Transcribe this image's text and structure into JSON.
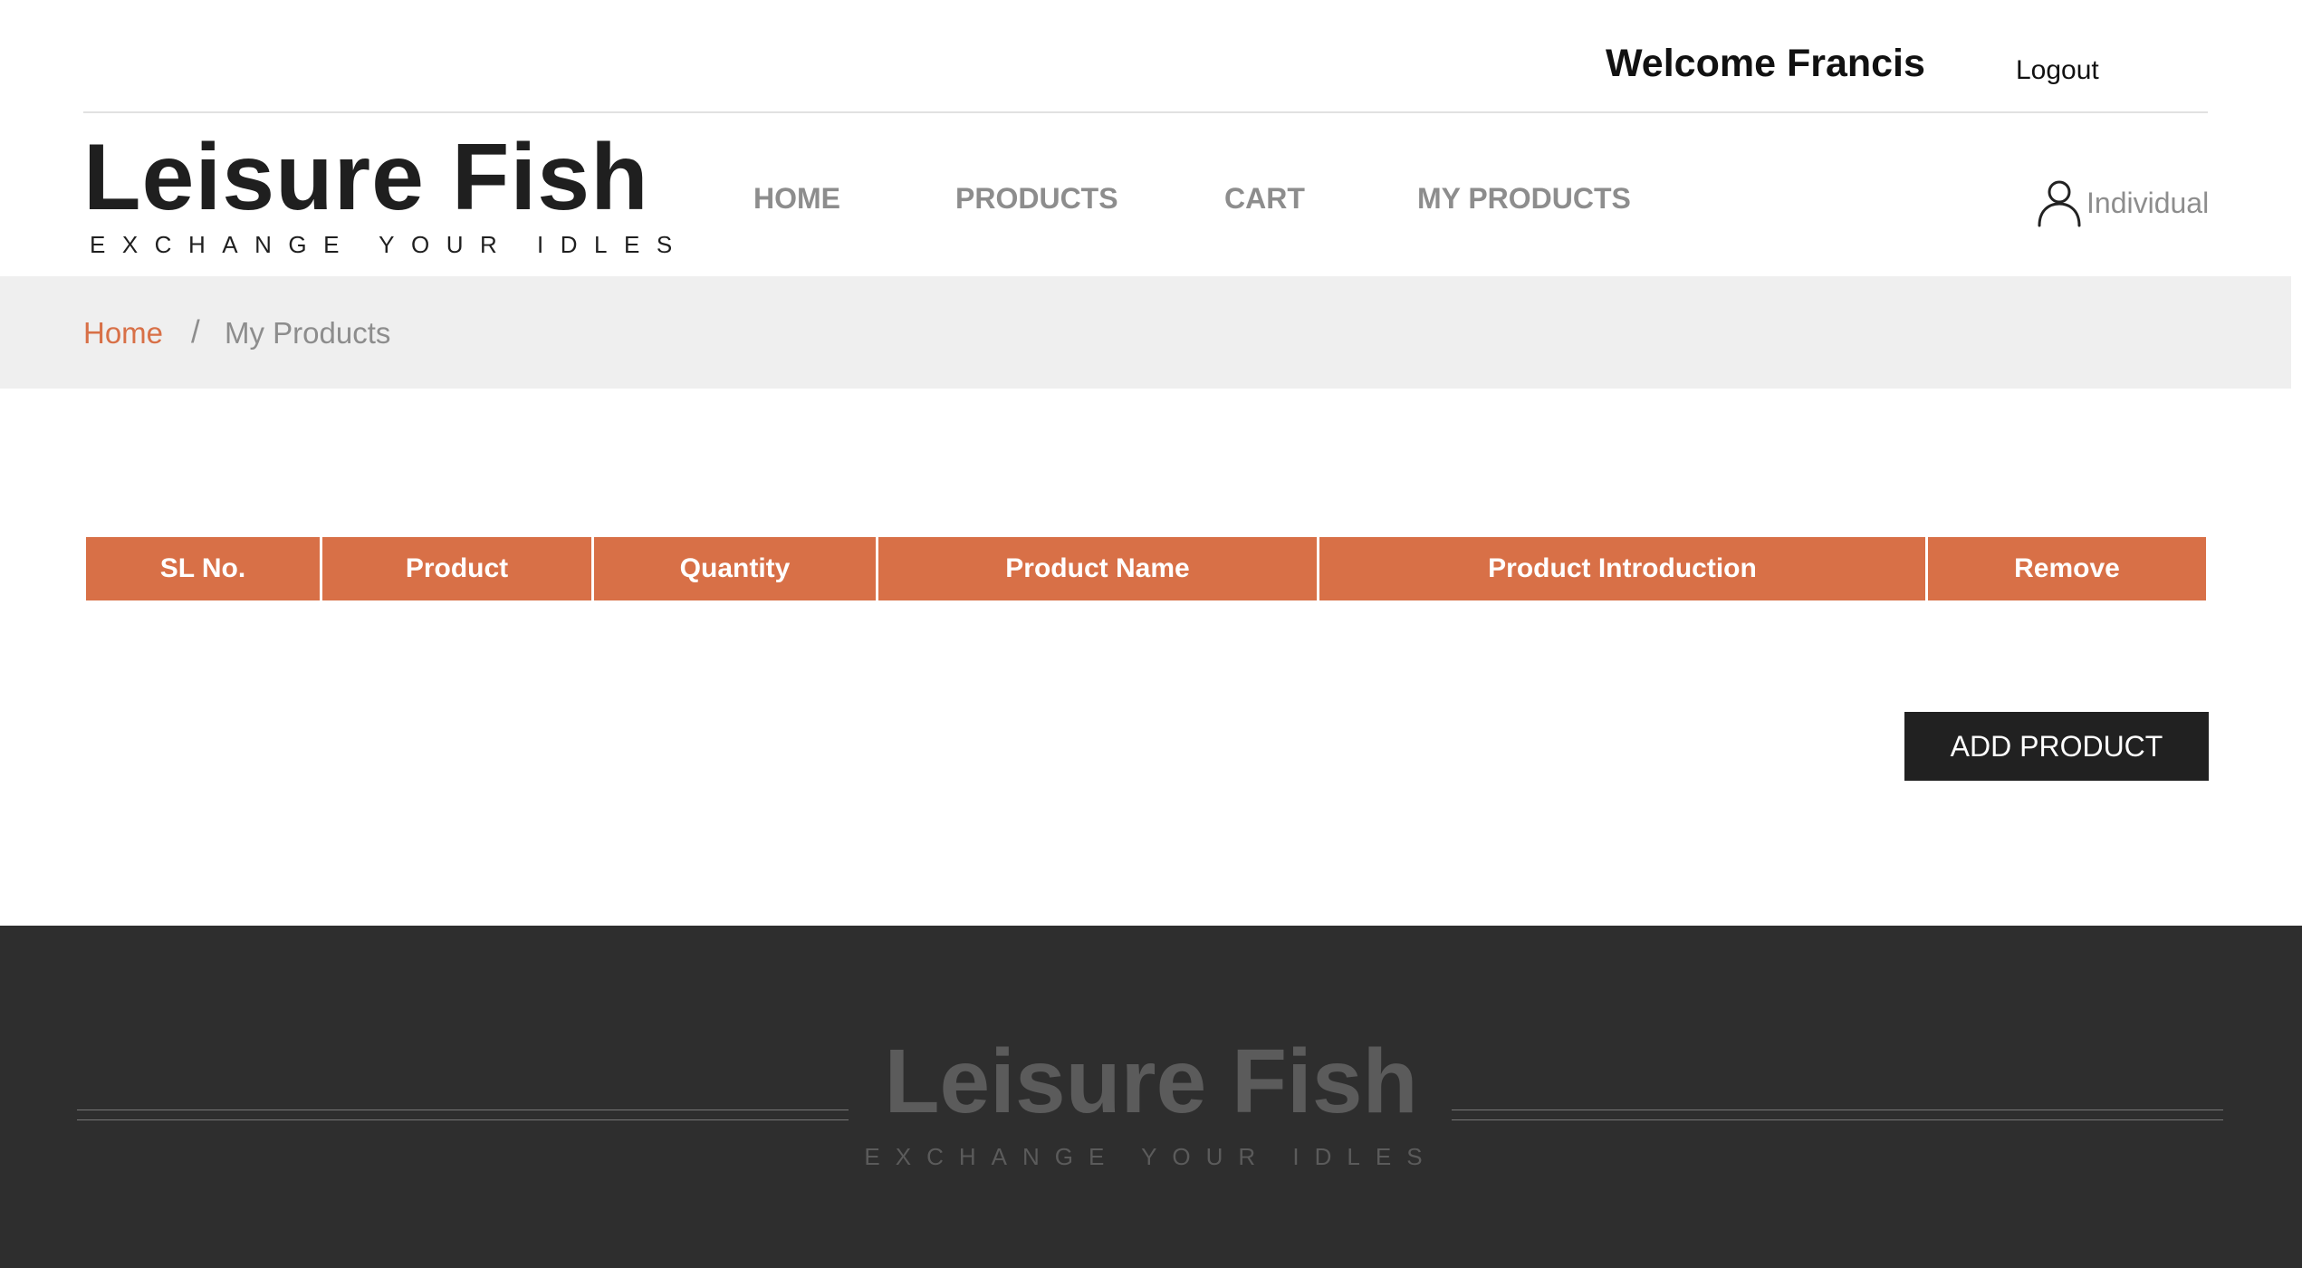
{
  "topbar": {
    "welcome": "Welcome Francis",
    "logout": "Logout"
  },
  "brand": {
    "title": "Leisure Fish",
    "tagline": "EXCHANGE YOUR IDLES"
  },
  "nav": {
    "items": [
      {
        "label": "HOME"
      },
      {
        "label": "PRODUCTS"
      },
      {
        "label": "CART"
      },
      {
        "label": "MY PRODUCTS"
      }
    ],
    "user_label": "Individual",
    "user_icon": "user-icon"
  },
  "breadcrumb": {
    "home": "Home",
    "separator": "/",
    "current": "My Products"
  },
  "table": {
    "columns": [
      "SL No.",
      "Product",
      "Quantity",
      "Product Name",
      "Product Introduction",
      "Remove"
    ],
    "rows": []
  },
  "actions": {
    "add_product": "ADD PRODUCT"
  },
  "footer": {
    "title": "Leisure Fish",
    "tagline": "EXCHANGE YOUR IDLES"
  },
  "colors": {
    "accent": "#d87047",
    "dark": "#212121",
    "footer_bg": "#2e2e2e",
    "breadcrumb_bg": "#efefef",
    "nav_text": "#8d8d8d"
  }
}
